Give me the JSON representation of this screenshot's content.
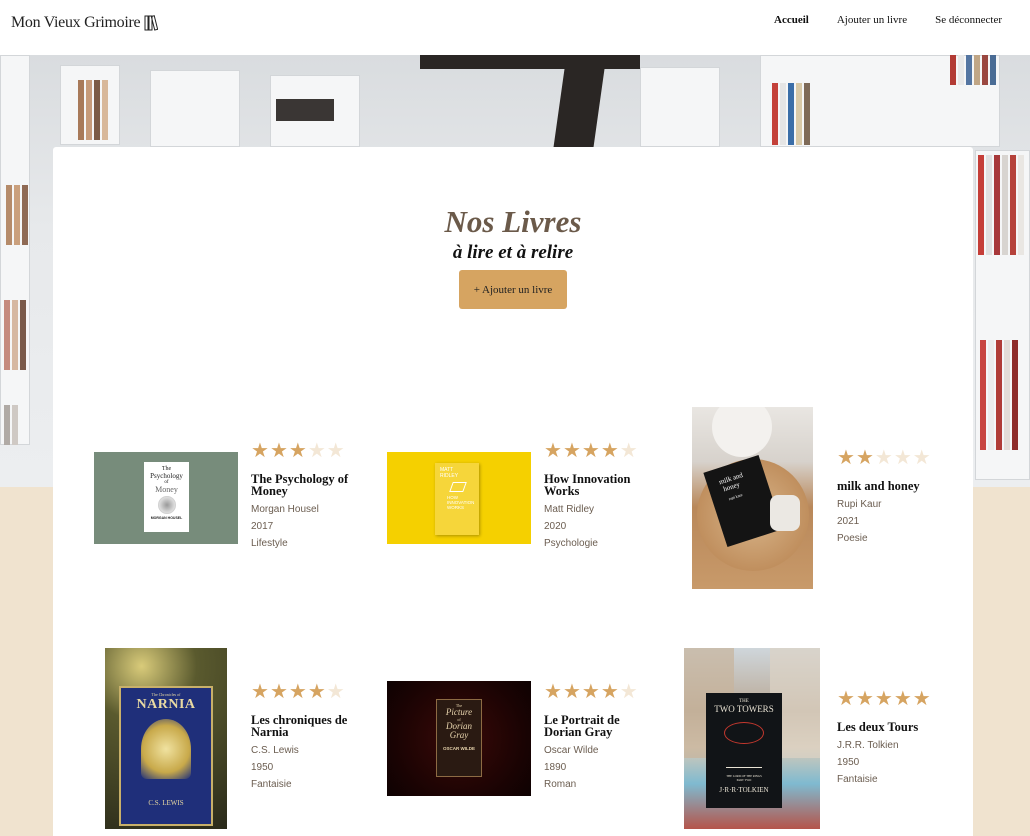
{
  "header": {
    "logo_text": "Mon Vieux Grimoire",
    "nav": [
      "Accueil",
      "Ajouter un livre",
      "Se déconnecter"
    ]
  },
  "hero": {
    "title": "Nos Livres",
    "subtitle": "à lire et à relire",
    "add_button": "+ Ajouter un livre"
  },
  "colors": {
    "accent": "#d6a461",
    "star_empty": "#f3e7d6",
    "background": "#f0e3cf"
  },
  "books": [
    {
      "title": "The Psychology of Money",
      "author": "Morgan Housel",
      "year": "2017",
      "genre": "Lifestyle",
      "rating": 3
    },
    {
      "title": "How Innovation Works",
      "author": "Matt Ridley",
      "year": "2020",
      "genre": "Psychologie",
      "rating": 4
    },
    {
      "title": "milk and honey",
      "author": "Rupi Kaur",
      "year": "2021",
      "genre": "Poesie",
      "rating": 2
    },
    {
      "title": "Les chroniques de Narnia",
      "author": "C.S. Lewis",
      "year": "1950",
      "genre": "Fantaisie",
      "rating": 4
    },
    {
      "title": "Le Portrait de Dorian Gray",
      "author": "Oscar Wilde",
      "year": "1890",
      "genre": "Roman",
      "rating": 4
    },
    {
      "title": "Les deux Tours",
      "author": "J.R.R. Tolkien",
      "year": "1950",
      "genre": "Fantaisie",
      "rating": 5
    }
  ],
  "covers": {
    "psychology": {
      "line1": "The",
      "line2": "Psychology",
      "line3": "of",
      "line4": "Money",
      "author": "MORGAN HOUSEL"
    },
    "innovation": {
      "line1": "MATT",
      "line2": "RIDLEY",
      "line3": "HOW",
      "line4": "INNOVATION",
      "line5": "WORKS"
    },
    "milk": {
      "line1": "milk and",
      "line2": "honey",
      "author": "rupi kaur"
    },
    "narnia": {
      "line1": "The Chronicles of",
      "line2": "NARNIA",
      "author": "C.S. LEWIS"
    },
    "dorian": {
      "line1": "The",
      "line2": "Picture",
      "line3": "of",
      "line4": "Dorian",
      "line5": "Gray",
      "author": "OSCAR WILDE"
    },
    "towers": {
      "line1": "THE",
      "line2": "TWO TOWERS",
      "line3": "THE LORD OF THE RINGS",
      "line4": "PART TWO",
      "author": "J·R·R·TOLKIEN"
    }
  }
}
